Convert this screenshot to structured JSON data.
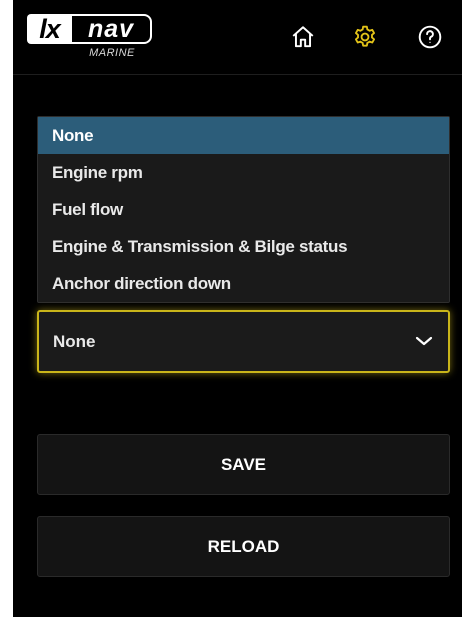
{
  "app": {
    "logo_lx": "lx",
    "logo_nav": "nav",
    "logo_sub": "MARINE"
  },
  "header": {
    "icons": [
      "home-icon",
      "gear-icon",
      "help-icon"
    ],
    "active_icon_color": "#e3c318"
  },
  "dropdown": {
    "options": [
      "None",
      "Engine rpm",
      "Fuel flow",
      "Engine & Transmission & Bilge status",
      "Anchor direction down"
    ],
    "highlighted_index": 0,
    "highlight_color": "#2c5d7a",
    "selected_value": "None",
    "focus_border_color": "#c9b51a"
  },
  "buttons": {
    "save_label": "SAVE",
    "reload_label": "RELOAD"
  }
}
